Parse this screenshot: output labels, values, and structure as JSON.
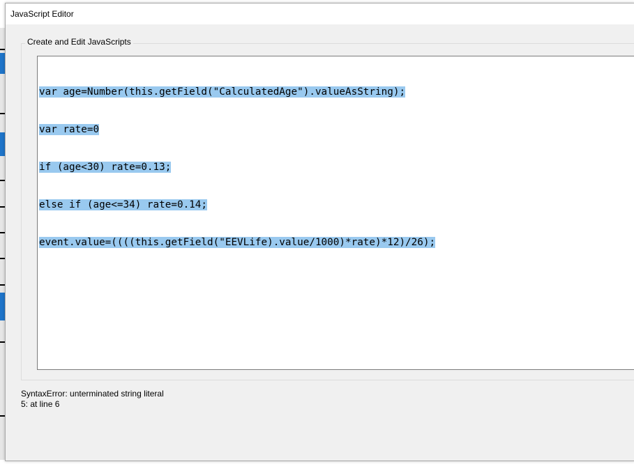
{
  "window": {
    "title": "JavaScript Editor"
  },
  "group": {
    "label": "Create and Edit JavaScripts"
  },
  "editor": {
    "lines": [
      "var age=Number(this.getField(\"CalculatedAge\").valueAsString);",
      "var rate=0",
      "if (age<30) rate=0.13;",
      "else if (age<=34) rate=0.14;",
      "event.value=((((this.getField(\"EEVLife).value/1000)*rate)*12)/26);"
    ],
    "selection_color": "#99c9ef"
  },
  "status": {
    "error": "SyntaxError: unterminated string literal",
    "location": "5: at line 6"
  }
}
